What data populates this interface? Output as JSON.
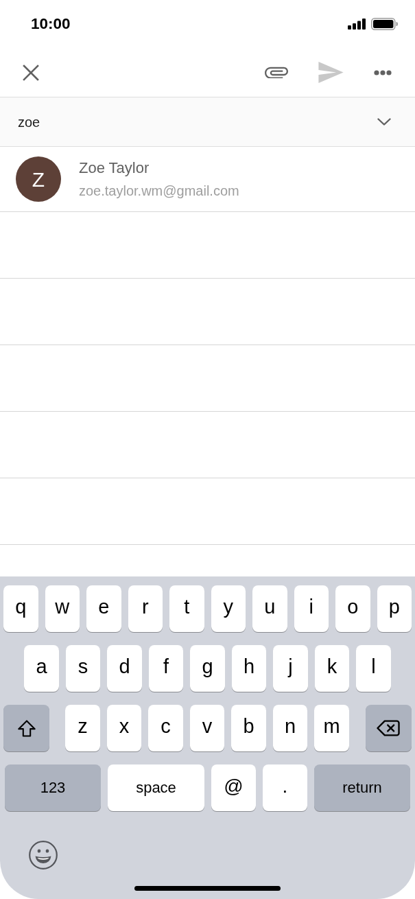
{
  "status_bar": {
    "time": "10:00"
  },
  "toolbar": {
    "send": {
      "disabled": true
    }
  },
  "recipient": {
    "value": "zoe"
  },
  "suggestions": [
    {
      "initial": "Z",
      "name": "Zoe Taylor",
      "email": "zoe.taylor.wm@gmail.com",
      "color": "#5d4037"
    }
  ],
  "keyboard": {
    "rows": [
      {
        "keys": [
          {
            "kind": "letter",
            "label": "q"
          },
          {
            "kind": "letter",
            "label": "w"
          },
          {
            "kind": "letter",
            "label": "e"
          },
          {
            "kind": "letter",
            "label": "r"
          },
          {
            "kind": "letter",
            "label": "t"
          },
          {
            "kind": "letter",
            "label": "y"
          },
          {
            "kind": "letter",
            "label": "u"
          },
          {
            "kind": "letter",
            "label": "i"
          },
          {
            "kind": "letter",
            "label": "o"
          },
          {
            "kind": "letter",
            "label": "p"
          }
        ]
      },
      {
        "keys": [
          {
            "kind": "letter",
            "label": "a"
          },
          {
            "kind": "letter",
            "label": "s"
          },
          {
            "kind": "letter",
            "label": "d"
          },
          {
            "kind": "letter",
            "label": "f"
          },
          {
            "kind": "letter",
            "label": "g"
          },
          {
            "kind": "letter",
            "label": "h"
          },
          {
            "kind": "letter",
            "label": "j"
          },
          {
            "kind": "letter",
            "label": "k"
          },
          {
            "kind": "letter",
            "label": "l"
          }
        ]
      },
      {
        "keys": [
          {
            "kind": "shift"
          },
          {
            "kind": "letter",
            "label": "z"
          },
          {
            "kind": "letter",
            "label": "x"
          },
          {
            "kind": "letter",
            "label": "c"
          },
          {
            "kind": "letter",
            "label": "v"
          },
          {
            "kind": "letter",
            "label": "b"
          },
          {
            "kind": "letter",
            "label": "n"
          },
          {
            "kind": "letter",
            "label": "m"
          },
          {
            "kind": "delete"
          }
        ]
      },
      {
        "keys": [
          {
            "kind": "numbers",
            "label": "123"
          },
          {
            "kind": "space",
            "label": "space"
          },
          {
            "kind": "symbol",
            "label": "@"
          },
          {
            "kind": "symbol",
            "label": "."
          },
          {
            "kind": "return",
            "label": "return"
          }
        ]
      }
    ]
  }
}
